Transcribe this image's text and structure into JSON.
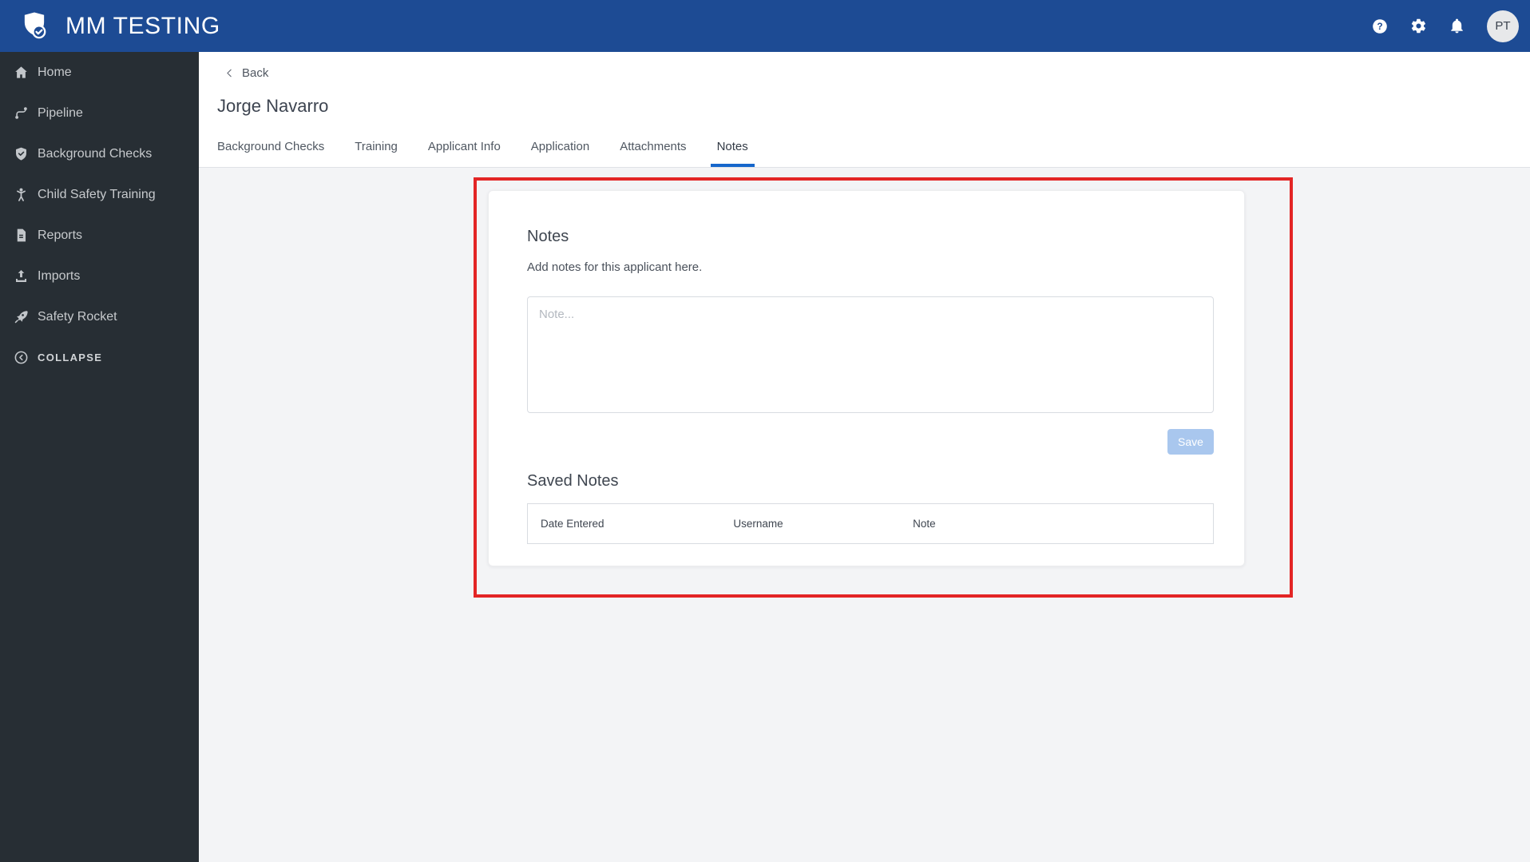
{
  "topbar": {
    "title": "MM TESTING",
    "logo_icon": "shield-check-logo",
    "help_icon": "help-icon",
    "settings_icon": "gear-icon",
    "notifications_icon": "bell-icon",
    "avatar_initials": "PT"
  },
  "sidebar": {
    "items": [
      {
        "label": "Home",
        "icon": "home-icon"
      },
      {
        "label": "Pipeline",
        "icon": "pipeline-icon"
      },
      {
        "label": "Background Checks",
        "icon": "shield-check-icon"
      },
      {
        "label": "Child Safety Training",
        "icon": "child-icon"
      },
      {
        "label": "Reports",
        "icon": "report-icon"
      },
      {
        "label": "Imports",
        "icon": "upload-icon"
      },
      {
        "label": "Safety Rocket",
        "icon": "rocket-icon"
      }
    ],
    "collapse": {
      "label": "COLLAPSE",
      "icon": "chevron-left-circle-icon"
    }
  },
  "page": {
    "back_label": "Back",
    "title": "Jorge Navarro",
    "tabs": [
      {
        "label": "Background Checks",
        "active": false
      },
      {
        "label": "Training",
        "active": false
      },
      {
        "label": "Applicant Info",
        "active": false
      },
      {
        "label": "Application",
        "active": false
      },
      {
        "label": "Attachments",
        "active": false
      },
      {
        "label": "Notes",
        "active": true
      }
    ]
  },
  "notes": {
    "heading": "Notes",
    "description": "Add notes for this applicant here.",
    "textarea": {
      "placeholder": "Note...",
      "value": ""
    },
    "save_label": "Save",
    "saved": {
      "heading": "Saved Notes",
      "columns": [
        "Date Entered",
        "Username",
        "Note"
      ],
      "rows": []
    }
  },
  "colors": {
    "topbar_bg": "#1d4b94",
    "sidebar_bg": "#272e34",
    "active_tab_underline": "#1566cb",
    "annotation_red": "#e32525",
    "save_button_bg": "#a9c7ee"
  }
}
